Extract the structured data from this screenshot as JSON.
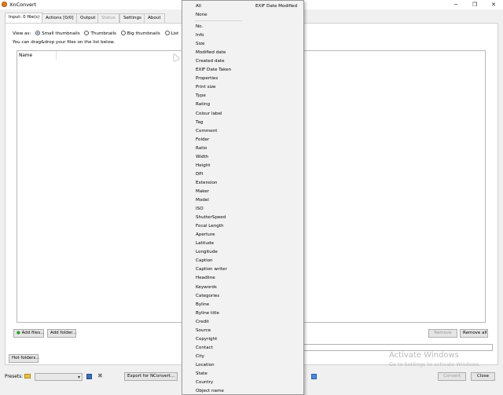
{
  "window": {
    "title": "XnConvert",
    "minimize": "─",
    "maximize": "❐",
    "close": "✕"
  },
  "tabs": [
    {
      "label": "Input: 0 file(s)",
      "state": "active"
    },
    {
      "label": "Actions [0/0]",
      "state": "normal"
    },
    {
      "label": "Output",
      "state": "normal"
    },
    {
      "label": "Status",
      "state": "disabled"
    },
    {
      "label": "Settings",
      "state": "normal"
    },
    {
      "label": "About",
      "state": "normal"
    }
  ],
  "input": {
    "view_as_label": "View as:",
    "view_options": [
      "Small thumbnails",
      "Thumbnails",
      "Big thumbnails",
      "List"
    ],
    "selected_view": "Small thumbnails",
    "hint": "You can drag&drop your files on the list below.",
    "column_name": "Name",
    "add_files": "Add files...",
    "add_folder": "Add folder...",
    "remove": "Remove",
    "remove_all": "Remove all",
    "hot_folders": "Hot folders..."
  },
  "footer": {
    "presets_label": "Presets:",
    "preset_value": "",
    "export_button": "Export for NConvert...",
    "convert_button": "Convert",
    "close_button": "Close"
  },
  "watermark": {
    "line1": "Activate Windows",
    "line2": "Go to Settings to activate Windows."
  },
  "column_menu": {
    "top": [
      "All",
      "None"
    ],
    "top_right": "EXIF Date Modified",
    "items": [
      "No.",
      "Info",
      "Size",
      "Modified date",
      "Created date",
      "EXIF Date Taken",
      "Properties",
      "Print size",
      "Type",
      "Rating",
      "Colour label",
      "Tag",
      "Comment",
      "Folder",
      "Ratio",
      "Width",
      "Height",
      "DPI",
      "Extension",
      "Maker",
      "Model",
      "ISO",
      "ShutterSpeed",
      "Focal Length",
      "Aperture",
      "Latitude",
      "Longitude",
      "Caption",
      "Caption writer",
      "Headline",
      "Keywords",
      "Categories",
      "Byline",
      "Byline title",
      "Credit",
      "Source",
      "Copyright",
      "Contact",
      "City",
      "Location",
      "State",
      "Country",
      "Object name"
    ]
  },
  "icons": {
    "app": "xnconvert-app-icon",
    "add": "plus-icon",
    "folder": "folder-icon",
    "save": "save-icon",
    "delete": "delete-icon"
  },
  "colors": {
    "accent": "#1a5fb4",
    "app_icon": "#e07b1a"
  }
}
